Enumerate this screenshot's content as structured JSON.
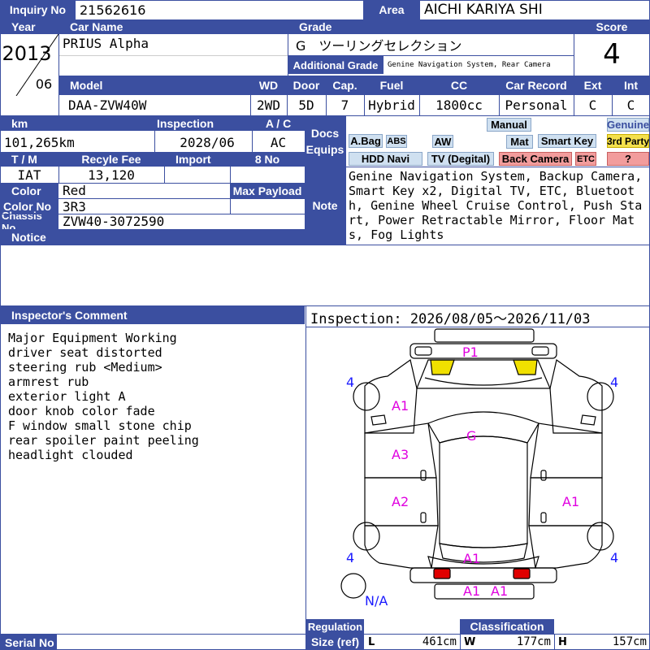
{
  "header": {
    "inquiry_label": "Inquiry No",
    "inquiry_value": "21562616",
    "area_label": "Area",
    "area_value": "AICHI KARIYA SHI"
  },
  "row1": {
    "year_label": "Year",
    "year_value": "2013",
    "month_value": "06",
    "carname_label": "Car Name",
    "carname_value": "PRIUS Alpha",
    "grade_label": "Grade",
    "grade_value": "G　ツーリングセレクション",
    "addgrade_label": "Additional Grade",
    "addgrade_value": "Genine Navigation System, Rear Camera",
    "score_label": "Score",
    "score_value": "4"
  },
  "row2": {
    "model_label": "Model",
    "model_value": "DAA-ZVW40W",
    "wd_label": "WD",
    "wd_value": "2WD",
    "door_label": "Door",
    "door_value": "5D",
    "cap_label": "Cap.",
    "cap_value": "7",
    "fuel_label": "Fuel",
    "fuel_value": "Hybrid",
    "cc_label": "CC",
    "cc_value": "1800cc",
    "record_label": "Car Record",
    "record_value": "Personal",
    "ext_label": "Ext",
    "ext_value": "C",
    "int_label": "Int",
    "int_value": "C"
  },
  "details": {
    "km_label": "km",
    "km_value": "101,265km",
    "inspection_label": "Inspection",
    "inspection_value": "2028/06",
    "ac_label": "A / C",
    "ac_value": "AC",
    "tm_label": "T / M",
    "tm_value": "IAT",
    "recycle_label": "Recyle Fee",
    "recycle_value": "13,120",
    "import_label": "Import",
    "import_value": "",
    "eightno_label": "8 No",
    "eightno_value": "",
    "color_label": "Color",
    "color_value": "Red",
    "maxpayload_label": "Max Payload",
    "maxpayload_value": "",
    "colorno_label": "Color No",
    "colorno_value": "3R3",
    "chassis_label": "Chassis No",
    "chassis_value": "ZVW40-3072590",
    "notice_label": "Notice",
    "notice_value": ""
  },
  "docs": {
    "docs_label": "Docs",
    "equips_label": "Equips",
    "tags": {
      "manual": "Manual",
      "genuine": "Genuine",
      "abag": "A.Bag",
      "abs": "ABS",
      "aw": "AW",
      "mat": "Mat",
      "smartkey": "Smart Key",
      "thirdparty": "3rd Party",
      "hddnavi": "HDD Navi",
      "tvdigital": "TV (Degital)",
      "backcamera": "Back Camera",
      "etc": "ETC",
      "question": "?"
    }
  },
  "note": {
    "label": "Note",
    "text": "Genine Navigation System, Backup Camera, Smart Key x2, Digital TV, ETC, Bluetooth, Genine Wheel Cruise Control, Push Start, Power Retractable Mirror, Floor Mats, Fog Lights"
  },
  "comment": {
    "label": "Inspector's Comment",
    "lines": [
      "Major Equipment Working",
      "driver seat distorted",
      "steering rub <Medium>",
      "armrest rub",
      "exterior light A",
      "door knob color fade",
      "F window small stone chip",
      "rear spoiler paint peeling",
      "headlight clouded"
    ]
  },
  "inspection_period": "Inspection: 2026/08/05～2026/11/03",
  "diagram": {
    "marks": {
      "p1": "P1",
      "a1_front_left": "A1",
      "g_roof": "G",
      "a3_left": "A3",
      "a2_left": "A2",
      "a1_right": "A1",
      "a1_rear": "A1",
      "a1_bumper_left": "A1",
      "a1_bumper_right": "A1"
    },
    "tires": {
      "fl": "4",
      "fr": "4",
      "rl": "4",
      "rr": "4",
      "spare": "N/A"
    },
    "colors": {
      "headlight": "#f0e000",
      "taillight": "#e00000",
      "mark": "#e000e0",
      "tire_text": "#1a1aff"
    }
  },
  "footer": {
    "serial_label": "Serial No",
    "regulation_label": "Regulation",
    "size_label": "Size (ref)",
    "classification_label": "Classification",
    "l_label": "L",
    "l_value": "461cm",
    "w_label": "W",
    "w_value": "177cm",
    "h_label": "H",
    "h_value": "157cm"
  },
  "theme": {
    "header_blue": "#3b4fa0"
  }
}
